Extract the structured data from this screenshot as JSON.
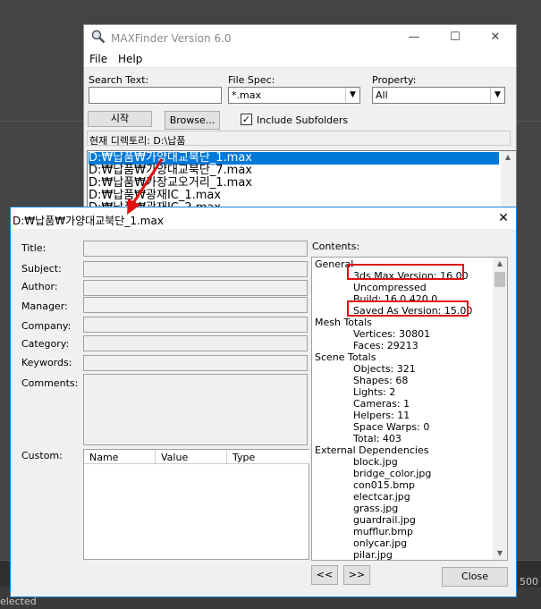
{
  "app": {
    "title": "MAXFinder Version 6.0",
    "menu": [
      "File",
      "Help"
    ],
    "search_text_label": "Search Text:",
    "search_text_value": "",
    "file_spec_label": "File Spec:",
    "file_spec_value": "*.max",
    "property_label": "Property:",
    "property_value": "All",
    "start_button": "시작",
    "browse_button": "Browse...",
    "include_subfolders": "Include Subfolders",
    "include_subfolders_checked": "✓",
    "current_dir": "현재 디렉토리: D:\\납품",
    "files": [
      "D:₩납품₩가양대교북단_1.max",
      "D:₩납품₩가양대교북단_7.max",
      "D:₩납품₩가장교오거리_1.max",
      "D:₩납품₩광재IC_1.max",
      "D:₩납품₩광재IC_2.max"
    ]
  },
  "dialog": {
    "title": "D:₩납품₩가양대교북단_1.max",
    "fields": [
      "Title:",
      "Subject:",
      "Author:",
      "Manager:",
      "Company:",
      "Category:",
      "Keywords:",
      "Comments:"
    ],
    "custom_label": "Custom:",
    "custom_columns": [
      "Name",
      "Value",
      "Type"
    ],
    "contents_label": "Contents:",
    "contents": [
      {
        "text": "General",
        "indent": 0
      },
      {
        "text": "3ds Max Version: 16.00",
        "indent": 2
      },
      {
        "text": "Uncompressed",
        "indent": 2
      },
      {
        "text": "Build: 16.0.420.0",
        "indent": 2
      },
      {
        "text": "Saved As Version: 15.00",
        "indent": 2
      },
      {
        "text": "Mesh Totals",
        "indent": 0
      },
      {
        "text": "Vertices: 30801",
        "indent": 2
      },
      {
        "text": "Faces: 29213",
        "indent": 2
      },
      {
        "text": "Scene Totals",
        "indent": 0
      },
      {
        "text": "Objects: 321",
        "indent": 2
      },
      {
        "text": "Shapes: 68",
        "indent": 2
      },
      {
        "text": "Lights: 2",
        "indent": 2
      },
      {
        "text": "Cameras: 1",
        "indent": 2
      },
      {
        "text": "Helpers: 11",
        "indent": 2
      },
      {
        "text": "Space Warps: 0",
        "indent": 2
      },
      {
        "text": "Total: 403",
        "indent": 2
      },
      {
        "text": "External Dependencies",
        "indent": 0
      },
      {
        "text": "block.jpg",
        "indent": 2
      },
      {
        "text": "bridge_color.jpg",
        "indent": 2
      },
      {
        "text": "con015.bmp",
        "indent": 2
      },
      {
        "text": "electcar.jpg",
        "indent": 2
      },
      {
        "text": "grass.jpg",
        "indent": 2
      },
      {
        "text": "guardrail.jpg",
        "indent": 2
      },
      {
        "text": "mufflur.bmp",
        "indent": 2
      },
      {
        "text": "onlycar.jpg",
        "indent": 2
      },
      {
        "text": "pilar.jpg",
        "indent": 2
      }
    ],
    "prev_button": "<<",
    "next_button": ">>",
    "close_button": "Close"
  },
  "background": {
    "status_text": "elected",
    "side_number": "500"
  },
  "colors": {
    "highlight": "#e01010",
    "selection": "#0078d7",
    "dialog_border": "#1883d7"
  }
}
